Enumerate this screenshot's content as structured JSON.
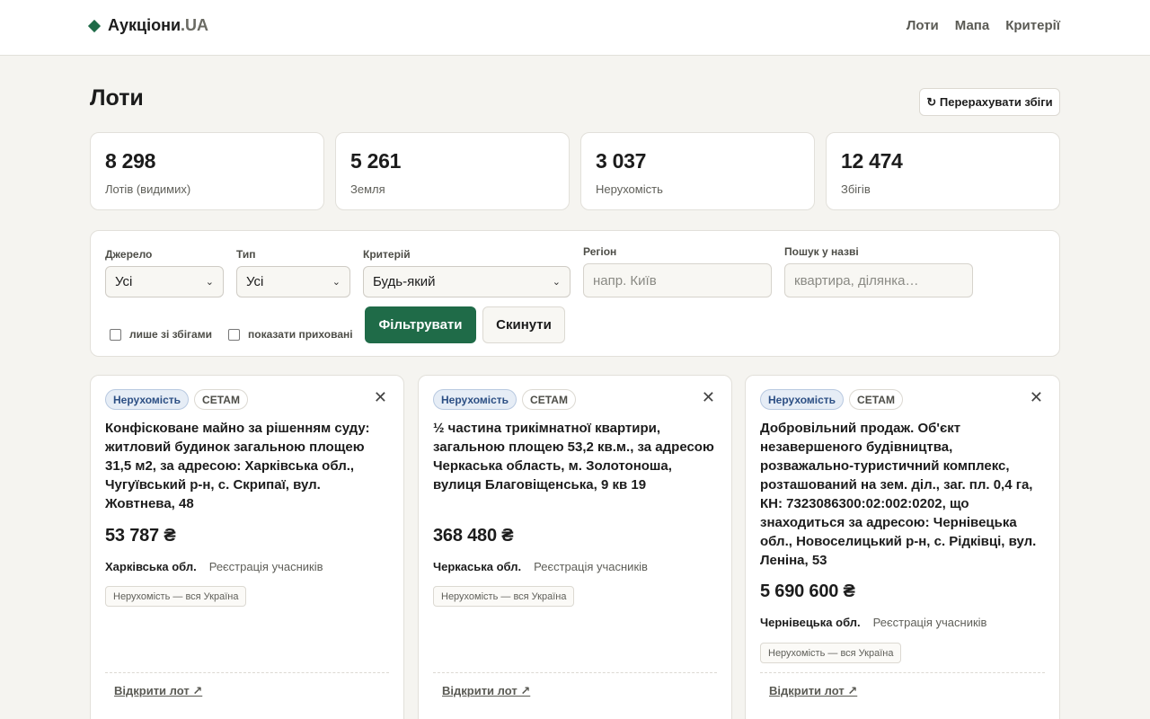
{
  "brand": {
    "name": "Аукціони",
    "suffix": ".UA"
  },
  "nav": [
    "Лоти",
    "Мапа",
    "Критерії"
  ],
  "page": {
    "title": "Лоти",
    "recount_label": "↻ Перерахувати збіги"
  },
  "stats": [
    {
      "value": "8 298",
      "label": "Лотів (видимих)"
    },
    {
      "value": "5 261",
      "label": "Земля"
    },
    {
      "value": "3 037",
      "label": "Нерухомість"
    },
    {
      "value": "12 474",
      "label": "Збігів"
    }
  ],
  "filters": {
    "source": {
      "label": "Джерело",
      "value": "Усі"
    },
    "type": {
      "label": "Тип",
      "value": "Усі"
    },
    "criterion": {
      "label": "Критерій",
      "value": "Будь-який"
    },
    "region": {
      "label": "Регіон",
      "placeholder": "напр. Київ"
    },
    "search": {
      "label": "Пошук у назві",
      "placeholder": "квартира, ділянка…"
    },
    "only_matches": "лише зі збігами",
    "show_hidden": "показати приховані",
    "filter_button": "Фільтрувати",
    "reset_button": "Скинути"
  },
  "cards": [
    {
      "type": "Нерухомість",
      "source": "СЕТАМ",
      "title": "Конфісковане майно за рішенням суду: житловий будинок загальною площею 31,5 м2, за адресою: Харківська обл., Чугуївський р-н, с. Скрипаї, вул. Жовтнева, 48",
      "price": "53 787 ₴",
      "region": "Харківська обл.",
      "status": "Реєстрація учасників",
      "tag": "Нерухомість — вся Україна",
      "link": "Відкрити лот ↗"
    },
    {
      "type": "Нерухомість",
      "source": "СЕТАМ",
      "title": "½ частина трикімнатної квартири, загальною площею 53,2 кв.м., за адресою Черкаська область, м. Золотоноша, вулиця Благовіщенська, 9 кв 19",
      "price": "368 480 ₴",
      "region": "Черкаська обл.",
      "status": "Реєстрація учасників",
      "tag": "Нерухомість — вся Україна",
      "link": "Відкрити лот ↗"
    },
    {
      "type": "Нерухомість",
      "source": "СЕТАМ",
      "title": "Добровільний продаж. Об'єкт незавершеного будівництва, розважально-туристичний комплекс, розташований на зем. діл., заг. пл. 0,4 га, КН: 7323086300:02:002:0202, що знаходиться за адресою: Чернівецька обл., Новоселицький р-н, с. Рідківці, вул. Леніна, 53",
      "price": "5 690 600 ₴",
      "region": "Чернівецька обл.",
      "status": "Реєстрація учасників",
      "tag": "Нерухомість — вся Україна",
      "link": "Відкрити лот ↗"
    }
  ]
}
